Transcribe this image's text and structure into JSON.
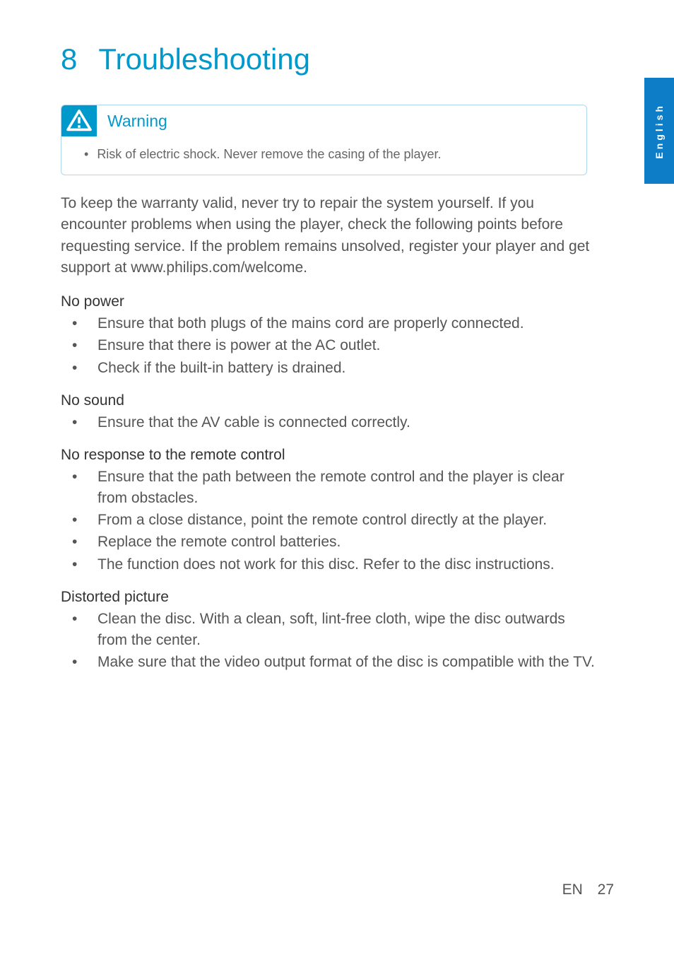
{
  "chapter": {
    "number": "8",
    "title": "Troubleshooting"
  },
  "languageTab": "English",
  "warning": {
    "title": "Warning",
    "items": [
      "Risk of electric shock. Never remove the casing of the player."
    ]
  },
  "intro": "To keep the warranty valid, never try to repair the system yourself. If you encounter problems when using the player, check the following points before requesting service. If the problem remains unsolved, register your player and get support at www.philips.com/welcome.",
  "sections": [
    {
      "heading": "No power",
      "items": [
        "Ensure that both plugs of the mains cord are properly connected.",
        "Ensure that there is power at the AC outlet.",
        "Check if the built-in battery is drained."
      ]
    },
    {
      "heading": "No sound",
      "items": [
        "Ensure that the AV cable is connected correctly."
      ]
    },
    {
      "heading": "No response to the remote control",
      "items": [
        "Ensure that the path between the remote control and the player is clear from obstacles.",
        "From a close distance, point the remote control directly at the player.",
        "Replace the remote control batteries.",
        "The function does not work for this disc. Refer to the disc instructions."
      ]
    },
    {
      "heading": "Distorted picture",
      "items": [
        "Clean the disc. With a clean, soft, lint-free cloth, wipe the disc outwards from the center.",
        "Make sure that the video output format of the disc is compatible with the TV."
      ]
    }
  ],
  "footer": {
    "lang": "EN",
    "page": "27"
  }
}
